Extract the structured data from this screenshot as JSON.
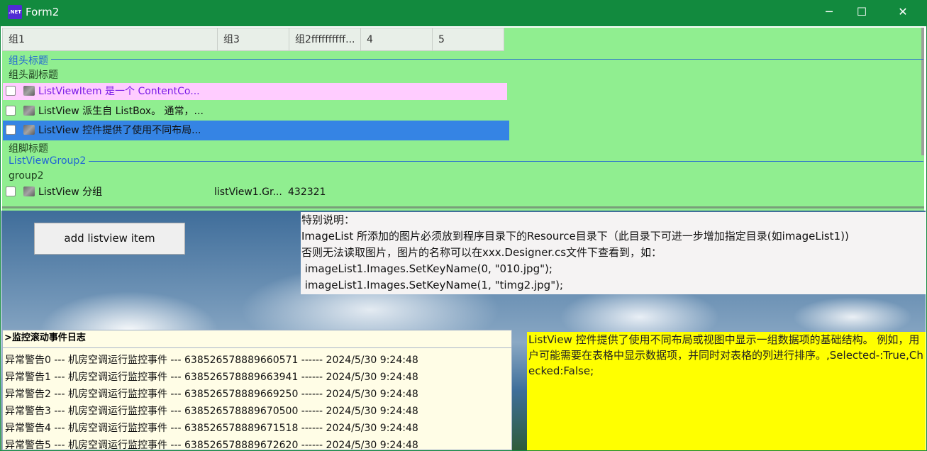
{
  "window": {
    "title": "Form2",
    "icon_text": ".NET",
    "minimize_icon": "─",
    "maximize_icon": "☐",
    "close_icon": "✕"
  },
  "listview": {
    "columns": [
      "组1",
      "组3",
      "组2ffffffffff...",
      "4",
      "5"
    ],
    "group1": {
      "header": "组头标题",
      "subtitle": "组头副标题",
      "footer": "组脚标题",
      "items": [
        {
          "text": "ListViewItem 是一个 ContentCo...",
          "checked": false,
          "state": "highlighted-pink"
        },
        {
          "text": "ListView 派生自 ListBox。 通常，...",
          "checked": false,
          "state": "normal"
        },
        {
          "text": "ListView 控件提供了使用不同布局...",
          "checked": false,
          "state": "selected"
        }
      ]
    },
    "group2": {
      "header": "ListViewGroup2",
      "subtitle": "group2",
      "items": [
        {
          "text": "ListView 分组",
          "sub1": "listView1.Gr...",
          "sub2": "432321",
          "checked": false
        }
      ]
    },
    "colors": {
      "background": "#90ee90",
      "pink_item": "#ffccff",
      "pink_text": "#7a1ae6",
      "selected": "#3584e4",
      "group_header": "#2266d4"
    }
  },
  "add_button": {
    "label": "add listview item"
  },
  "note": {
    "lines": [
      "特别说明：",
      "ImageList 所添加的图片必须放到程序目录下的Resource目录下（此目录下可进一步增加指定目录(如imageList1))",
      "否则无法读取图片，图片的名称可以在xxx.Designer.cs文件下查看到，如：",
      " imageList1.Images.SetKeyName(0, \"010.jpg\");",
      " imageList1.Images.SetKeyName(1, \"timg2.jpg\");"
    ]
  },
  "log": {
    "header": ">监控滚动事件日志",
    "lines": [
      "异常警告0 --- 机房空调运行监控事件 --- 638526578889660571 ------ 2024/5/30 9:24:48",
      "异常警告1 --- 机房空调运行监控事件 --- 638526578889663941 ------ 2024/5/30 9:24:48",
      "异常警告2 --- 机房空调运行监控事件 --- 638526578889669250 ------ 2024/5/30 9:24:48",
      "异常警告3 --- 机房空调运行监控事件 --- 638526578889670500 ------ 2024/5/30 9:24:48",
      "异常警告4 --- 机房空调运行监控事件 --- 638526578889671518 ------ 2024/5/30 9:24:48",
      "异常警告5 --- 机房空调运行监控事件 --- 638526578889672620 ------ 2024/5/30 9:24:48"
    ]
  },
  "status": {
    "text": "ListView 控件提供了使用不同布局或视图中显示一组数据项的基础结构。 例如，用户可能需要在表格中显示数据项，并同时对表格的列进行排序。,Selected-:True,Checked:False;"
  }
}
